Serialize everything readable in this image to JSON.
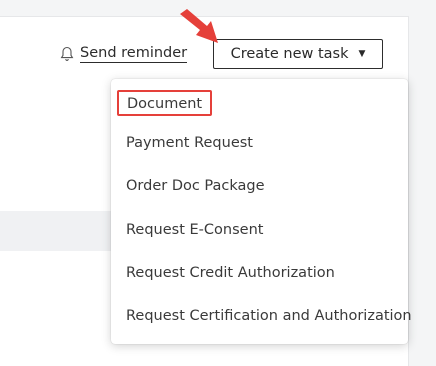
{
  "header": {
    "send_reminder_label": "Send reminder",
    "create_task_label": "Create new task",
    "bell_icon": "bell-icon",
    "caret_icon": "caret-down-icon"
  },
  "menu": {
    "items": [
      {
        "label": "Document",
        "highlighted": true
      },
      {
        "label": "Payment Request"
      },
      {
        "label": "Order Doc Package"
      },
      {
        "label": "Request E-Consent"
      },
      {
        "label": "Request Credit Authorization"
      },
      {
        "label": "Request Certification and Authorization"
      }
    ]
  },
  "annotation": {
    "arrow_color": "#e5403a",
    "highlight_color": "#e5403a"
  }
}
